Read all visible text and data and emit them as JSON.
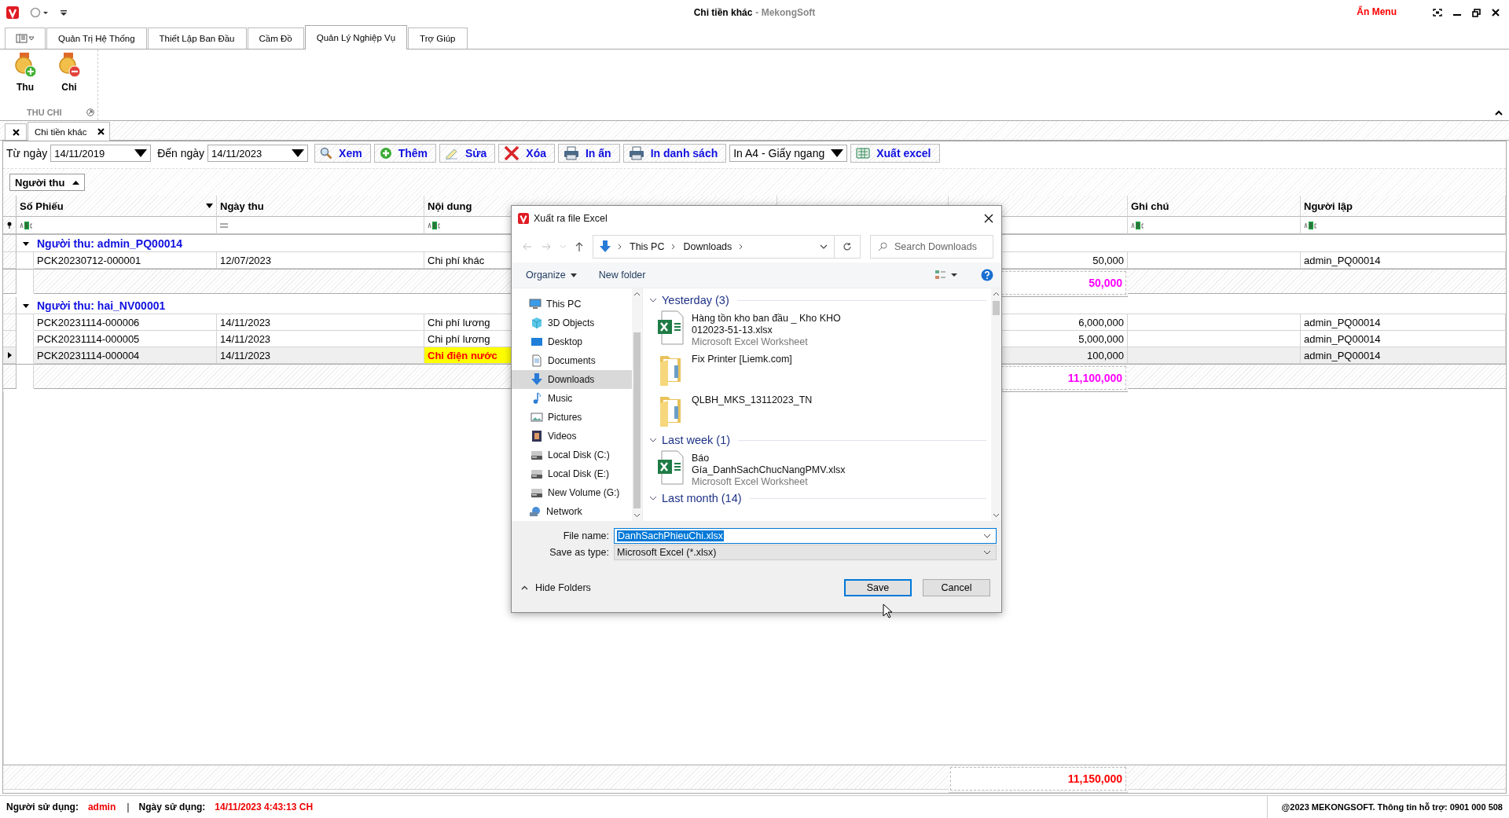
{
  "window": {
    "title": "Chi tiền khác",
    "app_name": "- MekongSoft",
    "hide_menu": "Ẩn Menu"
  },
  "ribbon": {
    "tabs": [
      {
        "label": "Quản Trị Hệ Thống",
        "selected": false
      },
      {
        "label": "Thiết Lập Ban Đầu",
        "selected": false
      },
      {
        "label": "Cầm Đồ",
        "selected": false
      },
      {
        "label": "Quản Lý Nghiệp Vụ",
        "selected": true
      },
      {
        "label": "Trợ Giúp",
        "selected": false
      }
    ],
    "buttons": [
      {
        "label": "Thu",
        "kind": "income"
      },
      {
        "label": "Chi",
        "kind": "expense"
      }
    ],
    "group_label": "THU CHI"
  },
  "document_tabs": [
    {
      "label": "Chi tiền khác",
      "selected": true
    }
  ],
  "toolbar": {
    "from_label": "Từ ngày",
    "from_date": "14/11/2019",
    "to_label": "Đến ngày",
    "to_date": "14/11/2023",
    "buttons": [
      {
        "label": "Xem",
        "kind": "search"
      },
      {
        "label": "Thêm",
        "kind": "add"
      },
      {
        "label": "Sửa",
        "kind": "edit"
      },
      {
        "label": "Xóa",
        "kind": "delete"
      },
      {
        "label": "In ấn",
        "kind": "print"
      },
      {
        "label": "In danh sách",
        "kind": "print"
      }
    ],
    "print_format": "In A4 - Giấy ngang",
    "export_button": "Xuất excel"
  },
  "group_by": {
    "label": "Người thu"
  },
  "grid": {
    "columns": [
      {
        "title": "Số Phiếu",
        "kind": "text",
        "dropdown": true
      },
      {
        "title": "Ngày thu",
        "kind": "date",
        "dropdown": false
      },
      {
        "title": "Nội dung",
        "kind": "text",
        "dropdown": false
      },
      {
        "title": "Ghi chú",
        "kind": "text",
        "dropdown": false
      },
      {
        "title": "Người lập",
        "kind": "text",
        "dropdown": false
      }
    ],
    "groups": [
      {
        "label": "Người thu: admin_PQ00014",
        "expanded": true,
        "total": "50,000",
        "rows": [
          {
            "so_phieu": "PCK20230712-000001",
            "ngay_thu": "12/07/2023",
            "noi_dung": "Chi phí khác",
            "column_4": "50,000",
            "nguoi_lap": "admin_PQ00014",
            "selected": false,
            "highlight": false
          }
        ]
      },
      {
        "label": "Người thu: hai_NV00001",
        "expanded": true,
        "total": "11,100,000",
        "rows": [
          {
            "so_phieu": "PCK20231114-000006",
            "ngay_thu": "14/11/2023",
            "noi_dung": "Chi phí lương",
            "column_4": "6,000,000",
            "nguoi_lap": "admin_PQ00014",
            "selected": false,
            "highlight": false
          },
          {
            "so_phieu": "PCK20231114-000005",
            "ngay_thu": "14/11/2023",
            "noi_dung": "Chi phí lương",
            "column_4": "5,000,000",
            "nguoi_lap": "admin_PQ00014",
            "selected": false,
            "highlight": false
          },
          {
            "so_phieu": "PCK20231114-000004",
            "ngay_thu": "14/11/2023",
            "noi_dung": "Chi điện nước",
            "column_4": "100,000",
            "nguoi_lap": "admin_PQ00014",
            "selected": true,
            "highlight": true
          }
        ]
      }
    ],
    "grand_total": "11,150,000"
  },
  "dialog": {
    "title": "Xuất ra file Excel",
    "path": [
      "This PC",
      "Downloads"
    ],
    "search_placeholder": "Search Downloads",
    "commands": [
      "Organize",
      "New folder"
    ],
    "nav": [
      {
        "label": "This PC",
        "kind": "pc",
        "selected": false,
        "children": [
          {
            "label": "3D Objects",
            "kind": "cube",
            "selected": false
          },
          {
            "label": "Desktop",
            "kind": "desktop",
            "selected": false
          },
          {
            "label": "Documents",
            "kind": "document",
            "selected": false
          },
          {
            "label": "Downloads",
            "kind": "download",
            "selected": true
          },
          {
            "label": "Music",
            "kind": "music",
            "selected": false
          },
          {
            "label": "Pictures",
            "kind": "pictures",
            "selected": false
          },
          {
            "label": "Videos",
            "kind": "video",
            "selected": false
          },
          {
            "label": "Local Disk (C:)",
            "kind": "drive",
            "selected": false
          },
          {
            "label": "Local Disk (E:)",
            "kind": "drive",
            "selected": false
          },
          {
            "label": "New Volume (G:)",
            "kind": "drive",
            "selected": false
          }
        ]
      },
      {
        "label": "Network",
        "kind": "network",
        "selected": false
      }
    ],
    "file_groups": [
      {
        "label": "Yesterday (3)",
        "items": [
          {
            "name": "Hàng tồn kho ban đầu _ Kho KHO 012023-51-13.xlsx",
            "type": "Microsoft Excel Worksheet",
            "kind": "excel"
          },
          {
            "name": "Fix Printer [Liemk.com]",
            "kind": "folder"
          },
          {
            "name": "QLBH_MKS_13112023_TN",
            "kind": "folder"
          }
        ]
      },
      {
        "label": "Last week (1)",
        "items": [
          {
            "name": "Báo Gía_DanhSachChucNangPMV.xlsx",
            "type": "Microsoft Excel Worksheet",
            "kind": "excel"
          }
        ]
      },
      {
        "label": "Last month (14)"
      }
    ],
    "file_name_label": "File name:",
    "file_name": "DanhSachPhieuChi.xlsx",
    "save_type_label": "Save as type:",
    "save_type": "Microsoft Excel (*.xlsx)",
    "hide_folders": "Hide Folders",
    "buttons": [
      {
        "label": "Save",
        "default": true
      },
      {
        "label": "Cancel",
        "default": false
      }
    ]
  },
  "status_bar": {
    "user_label": "Người sử dụng:",
    "user": "admin",
    "separator": "|",
    "date_label": "Ngày sử dụng:",
    "date": "14/11/2023 4:43:13 CH",
    "copyright": "@2023 MEKONGSOFT. Thông tin hỗ trợ: 0901 000 508"
  }
}
